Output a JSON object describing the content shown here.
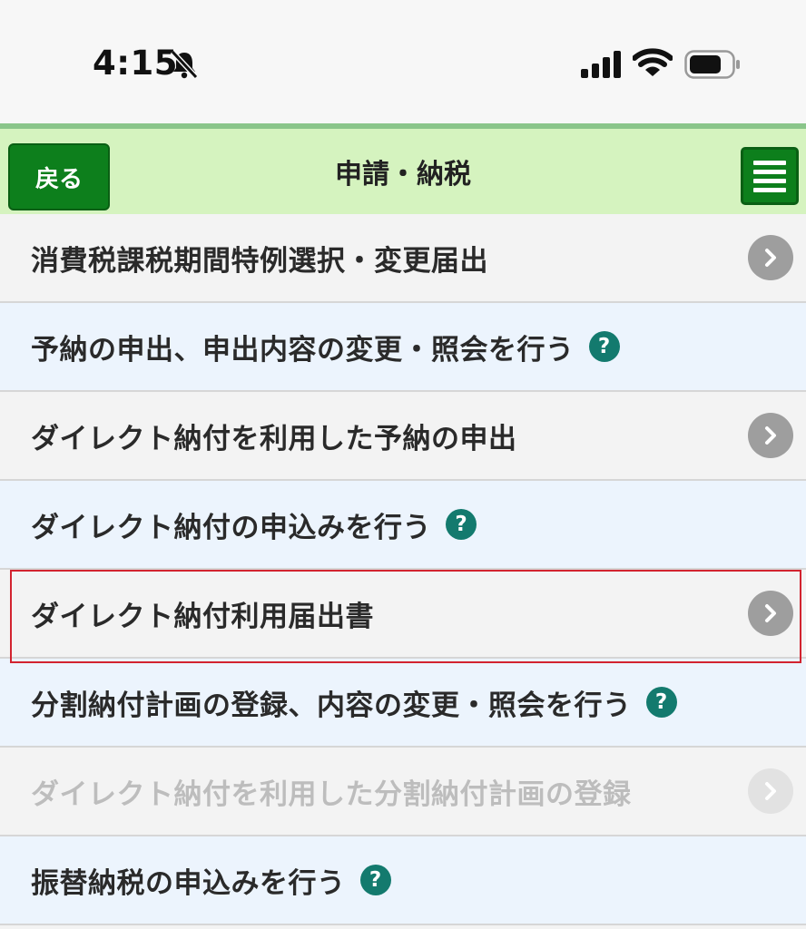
{
  "status_bar": {
    "time": "4:15",
    "icons": [
      "bell-slash-icon",
      "signal-icon",
      "wifi-icon",
      "battery-icon"
    ]
  },
  "header": {
    "back_label": "戻る",
    "title": "申請・納税",
    "menu_icon": "hamburger-menu-icon",
    "background_color": "#d5f3bf",
    "button_color": "#0d7f1c"
  },
  "list": {
    "items": [
      {
        "label": "消費税課税期間特例選択・変更届出",
        "icon": "chevron-right-icon",
        "style": "gray"
      },
      {
        "label": "予納の申出、申出内容の変更・照会を行う",
        "icon": "help-icon",
        "help_text": "?",
        "style": "blue"
      },
      {
        "label": "ダイレクト納付を利用した予納の申出",
        "icon": "chevron-right-icon",
        "style": "gray"
      },
      {
        "label": "ダイレクト納付の申込みを行う",
        "icon": "help-icon",
        "help_text": "?",
        "style": "blue"
      },
      {
        "label": "ダイレクト納付利用届出書",
        "icon": "chevron-right-icon",
        "style": "gray",
        "highlighted": true
      },
      {
        "label": "分割納付計画の登録、内容の変更・照会を行う",
        "icon": "help-icon",
        "help_text": "?",
        "style": "blue"
      },
      {
        "label": "ダイレクト納付を利用した分割納付計画の登録",
        "icon": "chevron-right-icon",
        "style": "gray",
        "disabled": true
      },
      {
        "label": "振替納税の申込みを行う",
        "icon": "help-icon",
        "help_text": "?",
        "style": "blue"
      }
    ],
    "help_color": "#137a6e",
    "chevron_color": "#9e9e9e",
    "highlight_color": "#d2232f"
  }
}
